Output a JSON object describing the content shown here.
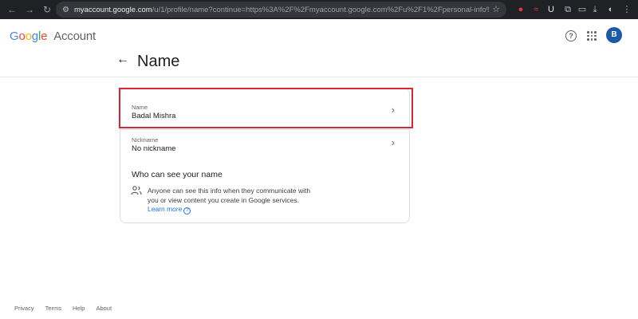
{
  "browser": {
    "url_host": "myaccount.google.com",
    "url_path": "/u/1/profile/name?continue=https%3A%2F%2Fmyaccount.google.com%2Fu%2F1%2Fpersonal-info%3Fhl%3Den%26ut..."
  },
  "header": {
    "logo_google": "Google",
    "logo_account": "Account",
    "avatar_letter": "B",
    "help_glyph": "?"
  },
  "page": {
    "back_glyph": "←",
    "title": "Name"
  },
  "card": {
    "name_label": "Name",
    "name_value": "Badal Mishra",
    "nickname_label": "Nickname",
    "nickname_value": "No nickname",
    "chevron": "›",
    "who_title": "Who can see your name",
    "who_text": "Anyone can see this info when they communicate with you or view content you create in Google services.",
    "learn_more": "Learn more"
  },
  "footer": {
    "privacy": "Privacy",
    "terms": "Terms",
    "help": "Help",
    "about": "About"
  },
  "colors": {
    "highlight": "#d62631",
    "link": "#1a73e8",
    "avatar_bg": "#1a5aa6"
  }
}
